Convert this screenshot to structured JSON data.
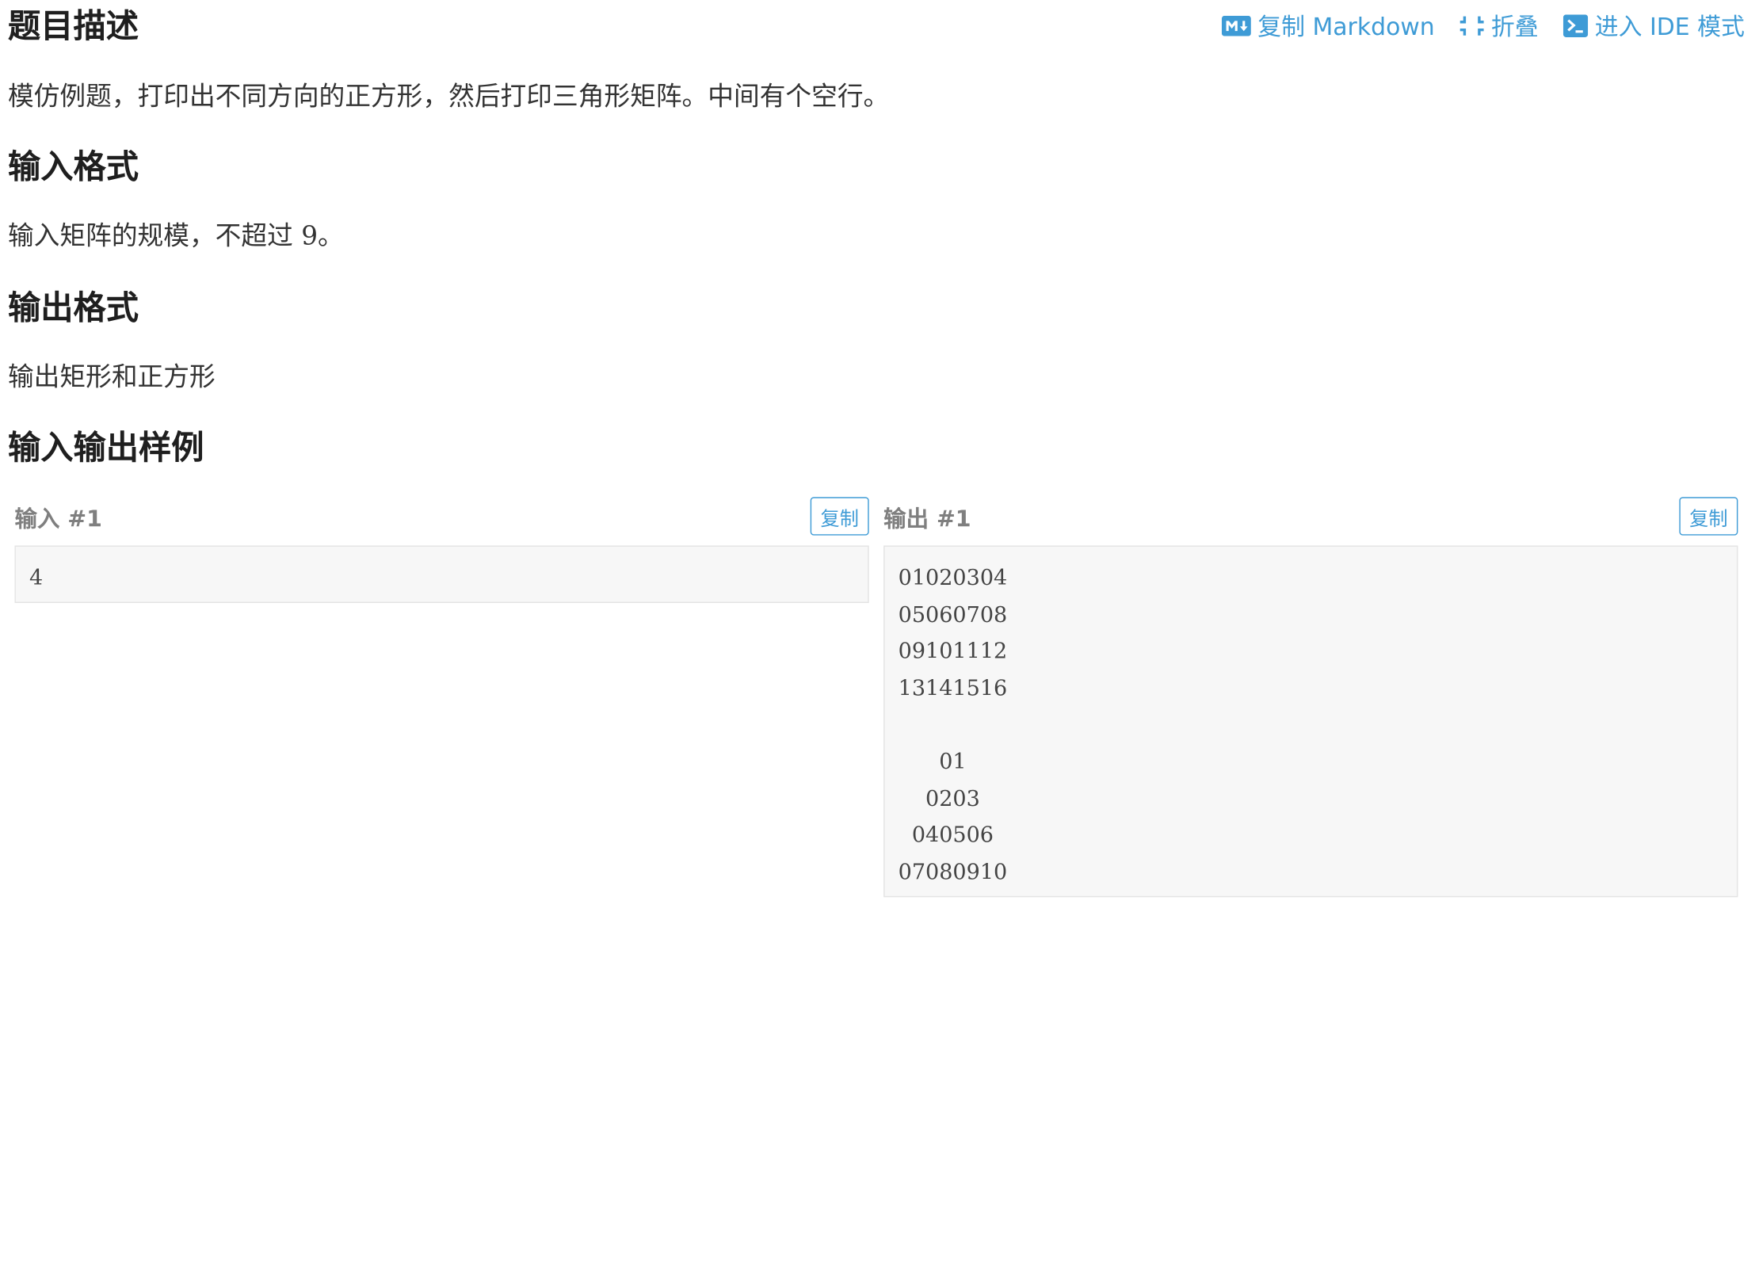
{
  "toolbar": {
    "copy_markdown": "复制 Markdown",
    "fold": "折叠",
    "ide_mode": "进入 IDE 模式",
    "accent_color": "#3e9bd6"
  },
  "description": {
    "title": "题目描述",
    "text": "模仿例题，打印出不同方向的正方形，然后打印三角形矩阵。中间有个空行。"
  },
  "input_format": {
    "title": "输入格式",
    "text_before": "输入矩阵的规模，不超过 ",
    "math": "9",
    "text_after": "。"
  },
  "output_format": {
    "title": "输出格式",
    "text": "输出矩形和正方形"
  },
  "samples": {
    "title": "输入输出样例",
    "input_label": "输入 #1",
    "output_label": "输出 #1",
    "copy_label": "复制",
    "input_value": "4",
    "output_value": "01020304\n05060708\n09101112\n13141516\n\n      01\n    0203\n  040506\n07080910"
  }
}
